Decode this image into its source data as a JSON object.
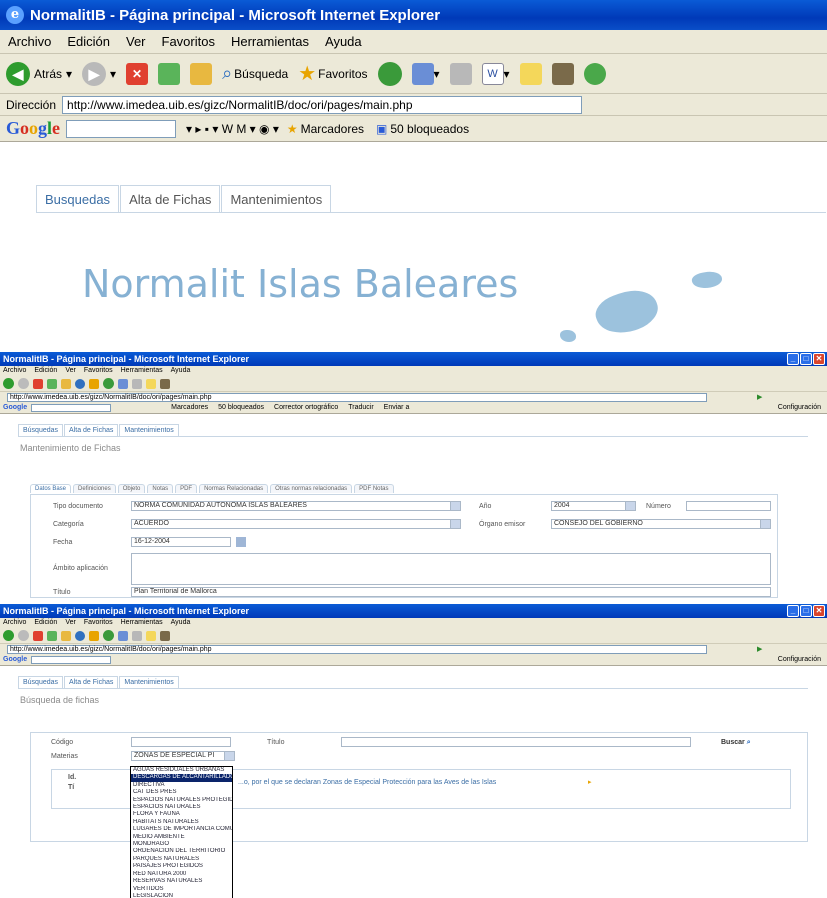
{
  "panel1": {
    "window_title": "NormalitIB - Página principal - Microsoft Internet Explorer",
    "menu": [
      "Archivo",
      "Edición",
      "Ver",
      "Favoritos",
      "Herramientas",
      "Ayuda"
    ],
    "toolbar": {
      "back": "Atrás",
      "search": "Búsqueda",
      "favorites": "Favoritos"
    },
    "address": {
      "label": "Dirección",
      "url": "http://www.imedea.uib.es/gizc/NormalitIB/doc/ori/pages/main.php"
    },
    "google": {
      "logo": "Google",
      "marcadores": "Marcadores",
      "bloqueados": "50 bloqueados"
    },
    "tabs": [
      "Busquedas",
      "Alta de Fichas",
      "Mantenimientos"
    ],
    "hero_title": "Normalit Islas Baleares"
  },
  "panel2": {
    "window_title": "NormalitIB - Página principal - Microsoft Internet Explorer",
    "menu": [
      "Archivo",
      "Edición",
      "Ver",
      "Favoritos",
      "Herramientas",
      "Ayuda"
    ],
    "address_url": "http://www.imedea.uib.es/gizc/NormalitIB/doc/ori/pages/main.php",
    "google_extras": [
      "Marcadores",
      "50 bloqueados",
      "Corrector ortográfico",
      "Traducir",
      "Enviar a"
    ],
    "config": "Configuración",
    "tabs": [
      "Búsquedas",
      "Alta de Fichas",
      "Mantenimientos"
    ],
    "heading": "Mantenimiento de Fichas",
    "subtabs": [
      "Datos Base",
      "Definiciones",
      "Objeto",
      "Notas",
      "PDF",
      "Normas Relacionadas",
      "Otras normas relacionadas",
      "PDF Notas"
    ],
    "fields": {
      "tipo_label": "Tipo documento",
      "tipo_value": "NORMA COMUNIDAD AUTONOMA ISLAS BALEARES",
      "ano_label": "Año",
      "ano_value": "2004",
      "numero_label": "Número",
      "categoria_label": "Categoría",
      "categoria_value": "ACUERDO",
      "organo_label": "Órgano emisor",
      "organo_value": "CONSEJO DEL GOBIERNO",
      "fecha_label": "Fecha",
      "fecha_value": "16-12-2004",
      "ambito_label": "Ámbito aplicación",
      "titulo_label": "Título",
      "titulo_value": "Plan Territorial de Mallorca"
    }
  },
  "panel3": {
    "window_title": "NormalitIB - Página principal - Microsoft Internet Explorer",
    "menu": [
      "Archivo",
      "Edición",
      "Ver",
      "Favoritos",
      "Herramientas",
      "Ayuda"
    ],
    "address_url": "http://www.imedea.uib.es/gizc/NormalitIB/doc/ori/pages/main.php",
    "config": "Configuración",
    "tabs": [
      "Búsquedas",
      "Alta de Fichas",
      "Mantenimientos"
    ],
    "heading": "Búsqueda de fichas",
    "codigo_label": "Código",
    "titulo_label": "Título",
    "materias_label": "Materias",
    "materias_value": "ZONAS DE ESPECIAL PI",
    "buscar_label": "Buscar",
    "result_headers": [
      "Id.",
      "Tí"
    ],
    "result_text": "...o, por el que se declaran Zonas de Especial Protección para las Aves de las Islas",
    "dropdown": [
      "AGUAS RESIDUALES URBANAS",
      "DESCARGAS DE ALCANTARILLADO",
      "DIRECTIVA",
      "CAT DES PRES",
      "ESPACIOS NATURALES PROTEGIDOS",
      "ESPACIOS NATURALES",
      "FLORA Y FAUNA",
      "HABITATS NATURALES",
      "LUGARES DE IMPORTANCIA COMUNITARIA",
      "MEDIO AMBIENTE",
      "MONDRAGO",
      "ORDENACION DEL TERRITORIO",
      "PARQUES NATURALES",
      "PAISAJES PROTEGIDOS",
      "RED NATURA 2000",
      "RESERVAS NATURALES",
      "VERTIDOS",
      "LEGISLACIÓN",
      "ZONAS DE ESPECIAL PROTECCIÓN",
      "ZONAS SENSIBLES"
    ],
    "selected_index": 1
  }
}
